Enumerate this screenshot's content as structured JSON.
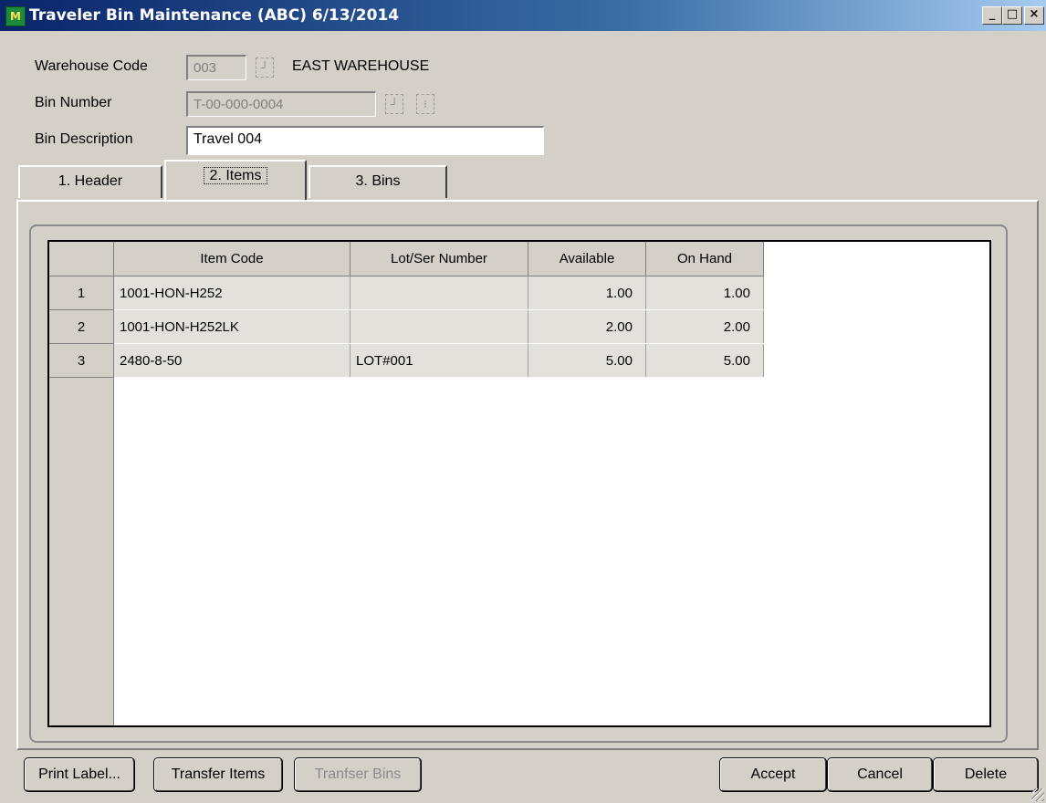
{
  "window": {
    "title": "Traveler Bin Maintenance (ABC) 6/13/2014",
    "app_icon": "M",
    "controls": {
      "minimize": "_",
      "maximize": "□",
      "close": "×"
    }
  },
  "form": {
    "warehouse_code_label": "Warehouse Code",
    "warehouse_code_value": "003",
    "warehouse_name": "EAST WAREHOUSE",
    "bin_number_label": "Bin Number",
    "bin_number_value": "T-00-000-0004",
    "bin_description_label": "Bin Description",
    "bin_description_value": "Travel 004"
  },
  "tabs": [
    {
      "label": "1. Header",
      "active": false
    },
    {
      "label": "2. Items",
      "active": true
    },
    {
      "label": "3. Bins",
      "active": false
    }
  ],
  "grid": {
    "columns": [
      "Item Code",
      "Lot/Ser Number",
      "Available",
      "On Hand"
    ],
    "rows": [
      {
        "num": "1",
        "item_code": "1001-HON-H252",
        "lot": "",
        "available": "1.00",
        "on_hand": "1.00"
      },
      {
        "num": "2",
        "item_code": "1001-HON-H252LK",
        "lot": "",
        "available": "2.00",
        "on_hand": "2.00"
      },
      {
        "num": "3",
        "item_code": "2480-8-50",
        "lot": "LOT#001",
        "available": "5.00",
        "on_hand": "5.00"
      }
    ]
  },
  "buttons": {
    "print_label": "Print Label...",
    "transfer_items": "Transfer Items",
    "transfer_bins": "Tranfser Bins",
    "accept": "Accept",
    "cancel": "Cancel",
    "delete": "Delete"
  }
}
